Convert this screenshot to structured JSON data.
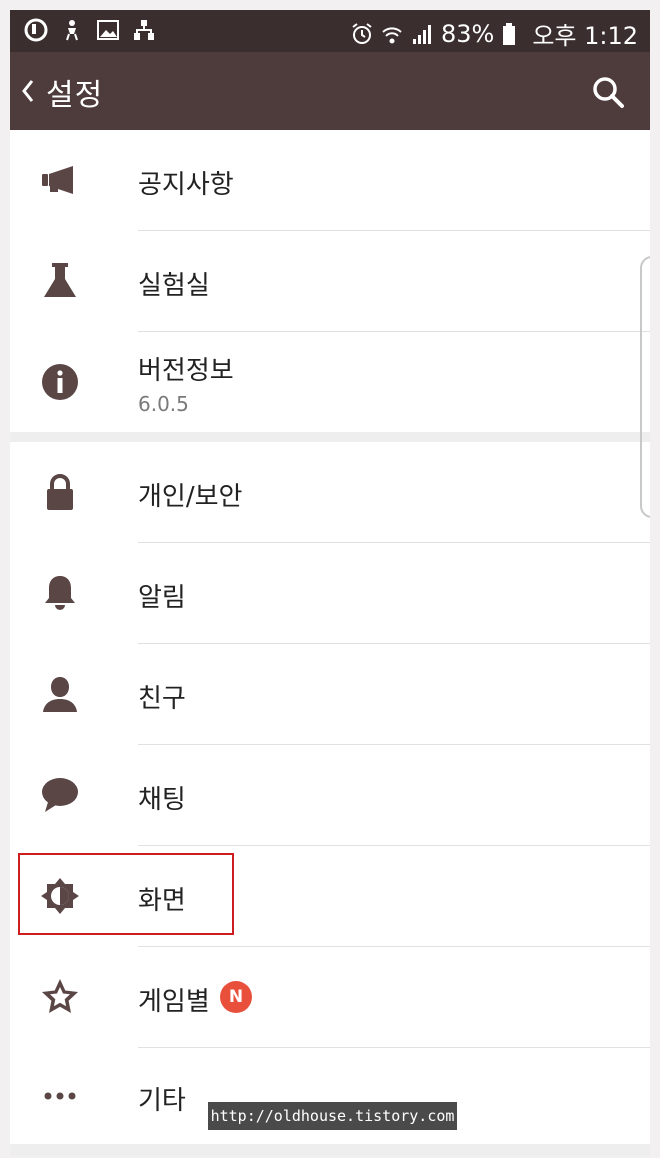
{
  "status_bar": {
    "battery": "83%",
    "time": "오후 1:12",
    "left_icons": [
      "app-u-icon",
      "person-icon",
      "image-icon",
      "sitemap-icon"
    ],
    "right_icons": [
      "alarm-icon",
      "wifi-icon",
      "signal-icon",
      "battery-icon"
    ]
  },
  "app_bar": {
    "back_icon": "chevron-left-icon",
    "title": "설정",
    "search_icon": "search-icon"
  },
  "settings": {
    "items": [
      {
        "label": "공지사항",
        "icon": "megaphone-icon"
      },
      {
        "label": "실험실",
        "icon": "flask-icon"
      },
      {
        "label": "버전정보",
        "sublabel": "6.0.5",
        "icon": "info-icon"
      },
      {
        "label": "개인/보안",
        "icon": "lock-icon"
      },
      {
        "label": "알림",
        "icon": "bell-icon"
      },
      {
        "label": "친구",
        "icon": "person-icon"
      },
      {
        "label": "채팅",
        "icon": "chat-bubble-icon"
      },
      {
        "label": "화면",
        "icon": "brightness-icon",
        "highlighted": true
      },
      {
        "label": "게임별",
        "icon": "star-icon",
        "badge": "N"
      },
      {
        "label": "기타",
        "icon": "more-dots-icon"
      }
    ]
  },
  "watermark": "http://oldhouse.tistory.com",
  "colors": {
    "status_bar": "#3a2e2e",
    "app_bar": "#4e3b3b",
    "icon": "#5b4646",
    "badge": "#e8503c",
    "highlight": "#cc1e1e"
  }
}
